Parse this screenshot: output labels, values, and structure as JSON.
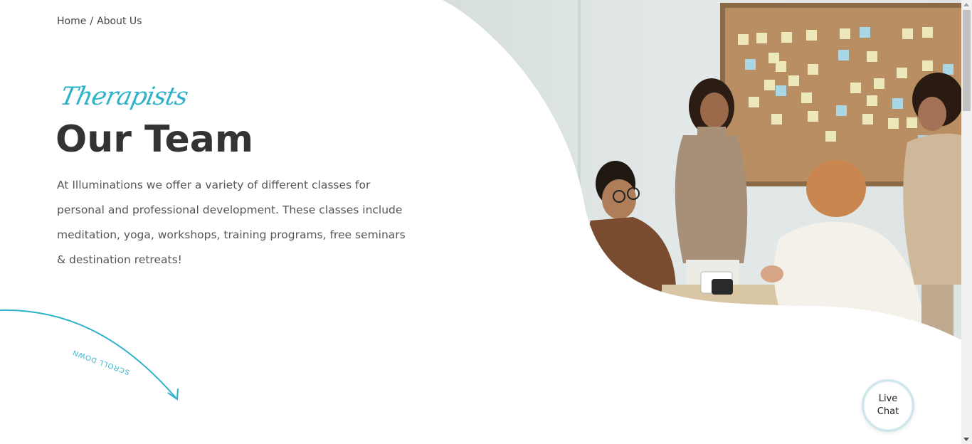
{
  "breadcrumb": {
    "home": "Home",
    "separator": "/",
    "current": "About Us"
  },
  "hero": {
    "eyebrow": "Therapists",
    "title": "Our Team",
    "intro": "At Illuminations we offer a variety of different classes for personal and professional development. These classes include meditation, yoga, workshops, training programs, free seminars & destination retreats!",
    "photo_icon": "team-meeting-photo"
  },
  "scroll": {
    "label": "SCROLL DOWN"
  },
  "live_chat": {
    "label": "Live Chat"
  },
  "colors": {
    "accent": "#2eb2c9",
    "heading": "#333333",
    "body_text": "#555555"
  }
}
